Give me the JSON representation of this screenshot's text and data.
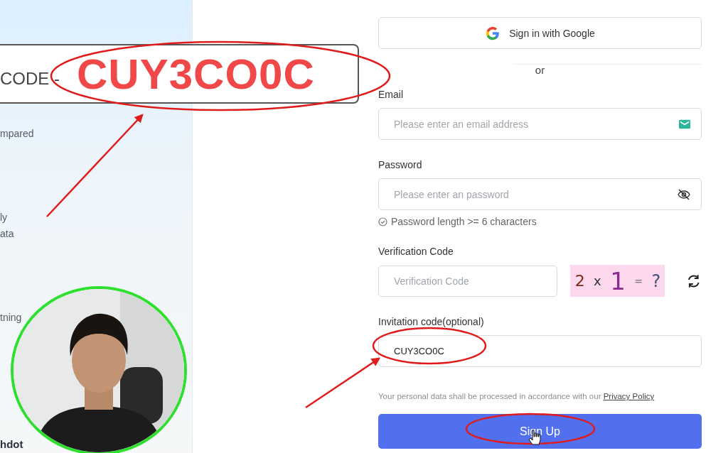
{
  "side_panel": {
    "snippets": [
      "mpared",
      "ly",
      "ata",
      "tning"
    ],
    "footer_text": "hdot"
  },
  "overlay_banner": {
    "label": "CODE -",
    "code": "CUY3CO0C"
  },
  "form": {
    "google_button": "Sign in with Google",
    "divider": "or",
    "email": {
      "label": "Email",
      "placeholder": "Please enter an email address"
    },
    "password": {
      "label": "Password",
      "placeholder": "Please enter an password",
      "hint": "Password length >= 6 characters"
    },
    "verification": {
      "label": "Verification Code",
      "placeholder": "Verification Code",
      "captcha": [
        "2",
        "x",
        "1",
        "=",
        "?"
      ]
    },
    "invitation": {
      "label": "Invitation code(optional)",
      "value": "CUY3CO0C"
    },
    "privacy": {
      "text": "Your personal data shall be processed in accordance with our",
      "link": "Privacy Policy"
    },
    "submit": "Sign Up"
  }
}
